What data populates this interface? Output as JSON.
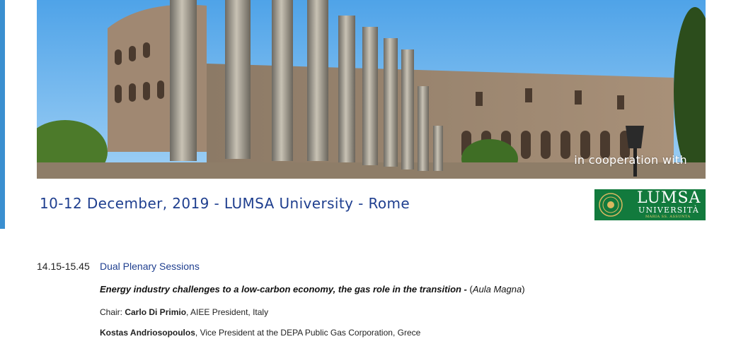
{
  "banner": {
    "image": "colosseum-roman-forum-columns",
    "overlay_text": "in cooperation with"
  },
  "conference": {
    "date_location": "10-12 December, 2019 - LUMSA University - Rome"
  },
  "partner_logo": {
    "name": "LUMSA",
    "subtitle": "UNIVERSITÀ",
    "tagline": "MARIA SS. ASSUNTA",
    "background": "#127a3d"
  },
  "program": {
    "session": {
      "time": "14.15-15.45",
      "title": "Dual Plenary Sessions"
    },
    "talk": {
      "title": "Energy industry challenges to a low-carbon economy, the gas role in the transition -",
      "room_open": " (",
      "room": "Aula Magna",
      "room_close": ")"
    },
    "chair": {
      "label": "Chair: ",
      "name": "Carlo Di Primio",
      "role": ", AIEE President, Italy"
    },
    "speaker": {
      "name": "Kostas Andriosopoulos",
      "role": ", Vice President at the DEPA Public Gas Corporation, Grece"
    }
  },
  "colors": {
    "accent_blue": "#1f3f8f",
    "left_strip": "#3a8fd0"
  }
}
